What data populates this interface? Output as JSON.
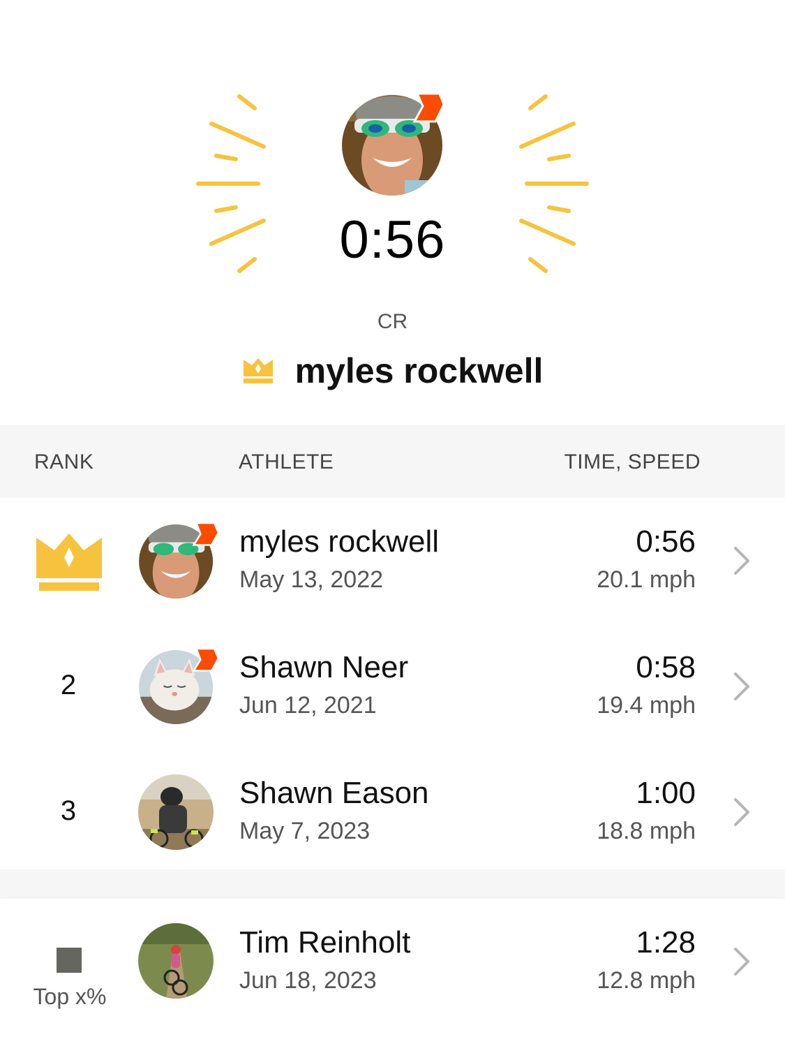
{
  "hero": {
    "time": "0:56",
    "label": "CR",
    "holder_name": "myles rockwell",
    "colors": {
      "accent": "#f7c33e",
      "badge": "#fc4c02"
    },
    "icons": [
      "crown-icon",
      "subscriber-badge-icon"
    ]
  },
  "columns": {
    "rank": "RANK",
    "athlete": "ATHLETE",
    "time_speed": "TIME, SPEED"
  },
  "rows": [
    {
      "rank": "1",
      "rank_icon": "crown-icon",
      "name": "myles rockwell",
      "date": "May 13, 2022",
      "time": "0:56",
      "speed": "20.1 mph",
      "badge": true
    },
    {
      "rank": "2",
      "name": "Shawn Neer",
      "date": "Jun 12, 2021",
      "time": "0:58",
      "speed": "19.4 mph",
      "badge": true
    },
    {
      "rank": "3",
      "name": "Shawn Eason",
      "date": "May 7, 2023",
      "time": "1:00",
      "speed": "18.8 mph",
      "badge": false
    }
  ],
  "you": {
    "rank_label": "Top x%",
    "name": "Tim Reinholt",
    "date": "Jun 18, 2023",
    "time": "1:28",
    "speed": "12.8 mph"
  }
}
